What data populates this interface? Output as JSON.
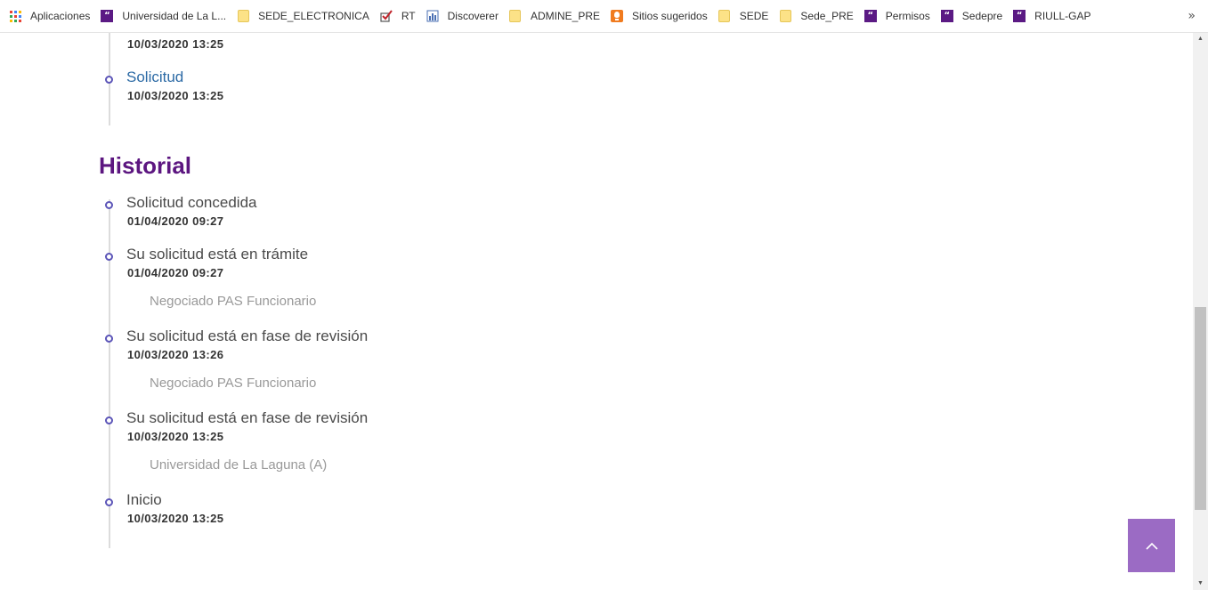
{
  "bookmarks": [
    {
      "label": "Aplicaciones",
      "icon": "apps-grid-icon"
    },
    {
      "label": "Universidad de La L...",
      "icon": "quote-icon"
    },
    {
      "label": "SEDE_ELECTRONICA",
      "icon": "folder-icon"
    },
    {
      "label": "RT",
      "icon": "checkmark-icon"
    },
    {
      "label": "Discoverer",
      "icon": "report-icon"
    },
    {
      "label": "ADMINE_PRE",
      "icon": "folder-icon"
    },
    {
      "label": "Sitios sugeridos",
      "icon": "lightbulb-icon"
    },
    {
      "label": "SEDE",
      "icon": "folder-icon"
    },
    {
      "label": "Sede_PRE",
      "icon": "folder-icon"
    },
    {
      "label": "Permisos",
      "icon": "quote-icon"
    },
    {
      "label": "Sedepre",
      "icon": "quote-icon"
    },
    {
      "label": "RIULL-GAP",
      "icon": "quote-icon"
    }
  ],
  "bookmarks_more": "»",
  "documents": {
    "partial_item": {
      "date": "10/03/2020 13:25"
    },
    "items": [
      {
        "title": "Solicitud",
        "date": "10/03/2020 13:25"
      }
    ]
  },
  "history": {
    "title": "Historial",
    "items": [
      {
        "title": "Solicitud concedida",
        "date": "01/04/2020 09:27",
        "note": ""
      },
      {
        "title": "Su solicitud está en trámite",
        "date": "01/04/2020 09:27",
        "note": "Negociado PAS Funcionario"
      },
      {
        "title": "Su solicitud está en fase de revisión",
        "date": "10/03/2020 13:26",
        "note": "Negociado PAS Funcionario"
      },
      {
        "title": "Su solicitud está en fase de revisión",
        "date": "10/03/2020 13:25",
        "note": "Universidad de La Laguna (A)"
      },
      {
        "title": "Inicio",
        "date": "10/03/2020 13:25",
        "note": ""
      }
    ]
  },
  "colors": {
    "accent_purple": "#5c1680",
    "timeline_dot": "#5c55b8",
    "link_blue": "#2c6aa5",
    "scroll_top_button": "#9b6bc4"
  }
}
